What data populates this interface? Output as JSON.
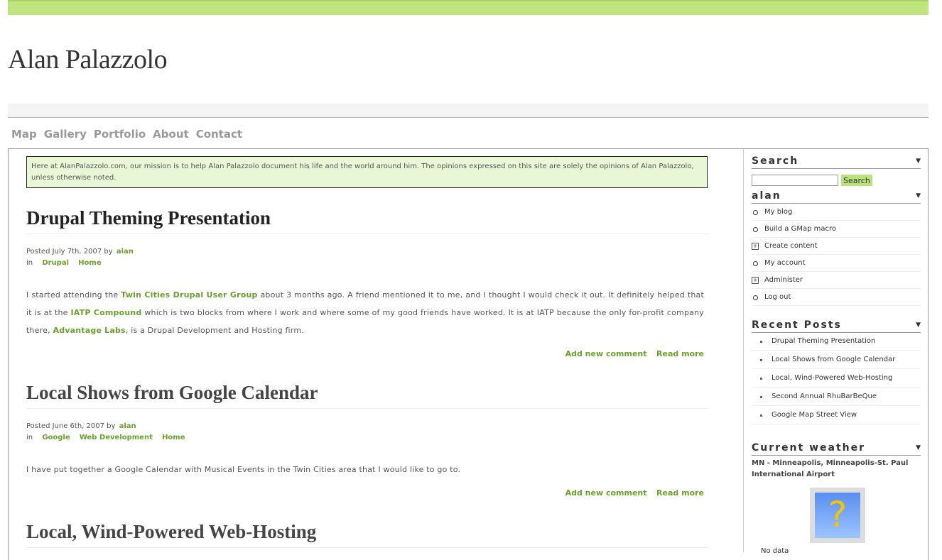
{
  "site": {
    "title": "Alan Palazzolo",
    "mission": "Here at AlanPalazzolo.com, our mission is to help Alan Palazzolo document his life and the world around him. The opinions expressed on this site are solely the opinions of Alan Palazzolo, unless otherwise noted."
  },
  "nav": [
    "Map",
    "Gallery",
    "Portfolio",
    "About",
    "Contact"
  ],
  "posts": [
    {
      "title": "Drupal Theming Presentation",
      "posted": "Posted July 7th, 2007 by",
      "author": "alan",
      "in": "in",
      "tags": [
        "Drupal",
        "Home"
      ],
      "body": [
        "I started attending the ",
        "Twin Cities Drupal User Group",
        " about 3 months ago. A friend mentioned it to me, and I thought I would check it out. It definitely helped that it is at the ",
        "IATP Compound",
        " which is two blocks from where I work and where some of my good friends have worked. It is at IATP because the only for-profit company there, ",
        "Advantage Labs",
        ", is a Drupal Development and Hosting firm."
      ],
      "links": [
        "Add new comment",
        "Read more"
      ]
    },
    {
      "title": "Local Shows from Google Calendar",
      "posted": "Posted June 6th, 2007 by",
      "author": "alan",
      "in": "in",
      "tags": [
        "Google",
        "Web Development",
        "Home"
      ],
      "body": "I have put together a Google Calendar with Musical Events in the Twin Cities area that I would like to go to.",
      "links": [
        "Add new comment",
        "Read more"
      ]
    },
    {
      "title": "Local, Wind-Powered Web-Hosting"
    }
  ],
  "sidebar": {
    "search": {
      "title": "Search",
      "button": "Search",
      "value": ""
    },
    "user": {
      "title": "alan",
      "items": [
        "My blog",
        "Build a GMap macro",
        "Create content",
        "My account",
        "Administer",
        "Log out"
      ]
    },
    "recent": {
      "title": "Recent Posts",
      "items": [
        "Drupal Theming Presentation",
        "Local Shows from Google Calendar",
        "Local, Wind-Powered Web-Hosting",
        "Second Annual RhuBarBeQue",
        "Google Map Street View"
      ]
    },
    "weather": {
      "title": "Current weather",
      "station": "MN - Minneapolis, Minneapolis-St. Paul International Airport",
      "image_glyph": "?",
      "status": "No data"
    }
  }
}
